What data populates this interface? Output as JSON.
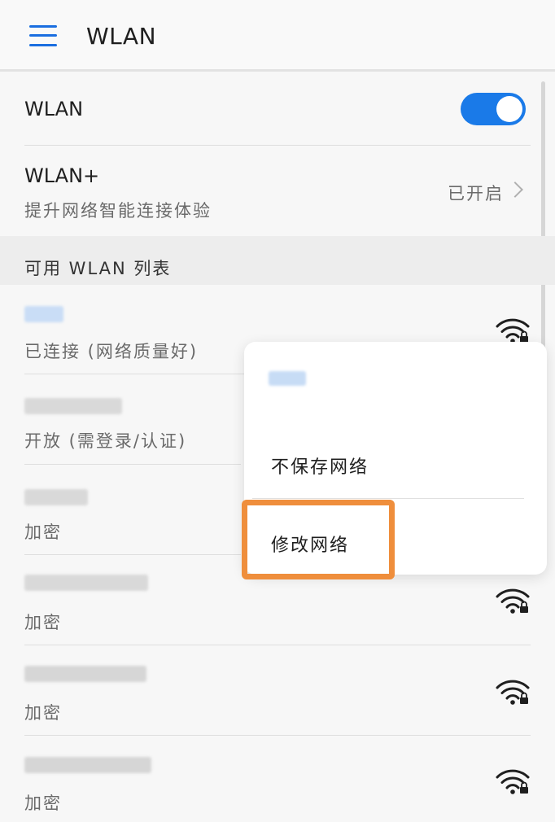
{
  "header": {
    "title": "WLAN"
  },
  "wlan_row": {
    "label": "WLAN",
    "enabled": true
  },
  "wlan_plus": {
    "title": "WLAN+",
    "subtitle": "提升网络智能连接体验",
    "status": "已开启"
  },
  "section": {
    "label": "可用 WLAN 列表"
  },
  "networks": [
    {
      "status": "已连接 (网络质量好)",
      "secured": true
    },
    {
      "status": "开放 (需登录/认证)",
      "secured": false
    },
    {
      "status": "加密",
      "secured": true
    },
    {
      "status": "加密",
      "secured": true
    },
    {
      "status": "加密",
      "secured": true
    },
    {
      "status": "加密",
      "secured": true
    }
  ],
  "context_menu": {
    "forget_label": "不保存网络",
    "modify_label": "修改网络"
  },
  "colors": {
    "accent": "#1a7ae8",
    "highlight": "#ef8e3c"
  }
}
